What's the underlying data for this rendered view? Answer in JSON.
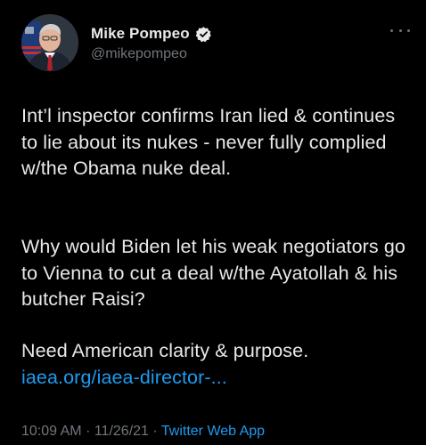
{
  "author": {
    "name": "Mike Pompeo",
    "handle": "@mikepompeo",
    "verified_icon": "verified-badge-icon"
  },
  "tweet": {
    "paragraph_1": "Int’l inspector confirms Iran lied & continues to lie about its nukes - never fully complied w/the Obama nuke deal.",
    "paragraph_2": "Why would Biden let his weak negotiators go to Vienna to cut a deal w/the Ayatollah & his butcher Raisi?",
    "paragraph_3": "Need American clarity & purpose.",
    "link_text": "iaea.org/iaea-director-..."
  },
  "meta": {
    "time": "10:09 AM",
    "separator_1": "·",
    "date": "11/26/21",
    "separator_2": "·",
    "source": "Twitter Web App"
  },
  "colors": {
    "background": "#000000",
    "text": "#e7e9ea",
    "secondary": "#71767b",
    "link": "#1d9bf0"
  }
}
